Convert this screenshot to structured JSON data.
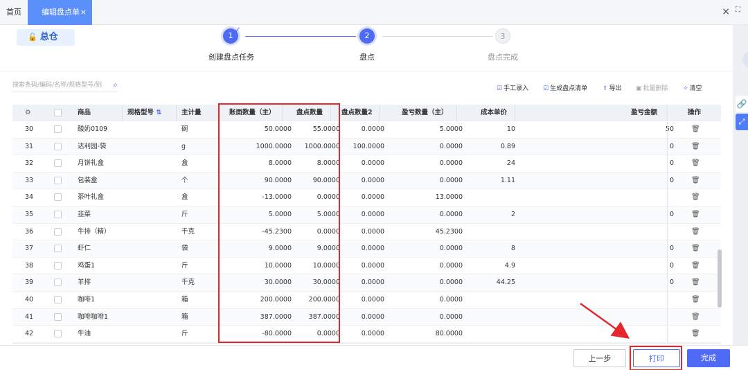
{
  "tabs": {
    "home": "首页",
    "active": "编辑盘点单",
    "close": "×"
  },
  "window": {
    "close": "×",
    "fullscreen": "⛶"
  },
  "warehouse": {
    "name": "总仓"
  },
  "steps": [
    {
      "num": "1",
      "label": "创建盘点任务",
      "state": "done"
    },
    {
      "num": "2",
      "label": "盘点",
      "state": "current"
    },
    {
      "num": "3",
      "label": "盘点完成",
      "state": "todo"
    }
  ],
  "search": {
    "placeholder": "搜索条码/编码/名称/规格型号/别"
  },
  "toolbar": {
    "manual": "手工录入",
    "generate": "生成盘点清单",
    "export": "导出",
    "batch_delete": "批量删除",
    "clear": "清空"
  },
  "table": {
    "headers": {
      "product": "商品",
      "spec": "规格型号",
      "unit": "主计量",
      "book_qty": "账面数量（主）",
      "count_qty": "盘点数量",
      "count_qty2": "盘点数量2",
      "diff_qty": "盈亏数量（主）",
      "unit_cost": "成本单价",
      "diff_amount": "盈亏金额",
      "op": "操作"
    },
    "rows": [
      {
        "no": "30",
        "name": "酸奶0109",
        "unit": "碗",
        "book": "50.0000",
        "count": "55.0000",
        "count2": "0.0000",
        "diff": "5.0000",
        "cost": "10",
        "amount": "50"
      },
      {
        "no": "31",
        "name": "达利园-袋",
        "unit": "g",
        "book": "1000.0000",
        "count": "1000.0000",
        "count2": "100.0000",
        "diff": "0.0000",
        "cost": "0.89",
        "amount": "0"
      },
      {
        "no": "32",
        "name": "月饼礼盒",
        "unit": "盒",
        "book": "8.0000",
        "count": "8.0000",
        "count2": "0.0000",
        "diff": "0.0000",
        "cost": "24",
        "amount": "0"
      },
      {
        "no": "33",
        "name": "包装盒",
        "unit": "个",
        "book": "90.0000",
        "count": "90.0000",
        "count2": "0.0000",
        "diff": "0.0000",
        "cost": "1.11",
        "amount": "0"
      },
      {
        "no": "34",
        "name": "茶叶礼盒",
        "unit": "盒",
        "book": "-13.0000",
        "count": "0.0000",
        "count2": "0.0000",
        "diff": "13.0000",
        "cost": "",
        "amount": ""
      },
      {
        "no": "35",
        "name": "韭菜",
        "unit": "斤",
        "book": "5.0000",
        "count": "5.0000",
        "count2": "0.0000",
        "diff": "0.0000",
        "cost": "2",
        "amount": "0"
      },
      {
        "no": "36",
        "name": "牛排（精）",
        "unit": "千克",
        "book": "-45.2300",
        "count": "0.0000",
        "count2": "0.0000",
        "diff": "45.2300",
        "cost": "",
        "amount": ""
      },
      {
        "no": "37",
        "name": "虾仁",
        "unit": "袋",
        "book": "9.0000",
        "count": "9.0000",
        "count2": "0.0000",
        "diff": "0.0000",
        "cost": "8",
        "amount": "0"
      },
      {
        "no": "38",
        "name": "鸡蛋1",
        "unit": "斤",
        "book": "10.0000",
        "count": "10.0000",
        "count2": "0.0000",
        "diff": "0.0000",
        "cost": "4.9",
        "amount": "0"
      },
      {
        "no": "39",
        "name": "羊排",
        "unit": "千克",
        "book": "30.0000",
        "count": "30.0000",
        "count2": "0.0000",
        "diff": "0.0000",
        "cost": "44.25",
        "amount": "0"
      },
      {
        "no": "40",
        "name": "咖啡1",
        "unit": "箱",
        "book": "200.0000",
        "count": "200.0000",
        "count2": "0.0000",
        "diff": "0.0000",
        "cost": "",
        "amount": ""
      },
      {
        "no": "41",
        "name": "咖啡咖啡1",
        "unit": "箱",
        "book": "387.0000",
        "count": "387.0000",
        "count2": "0.0000",
        "diff": "0.0000",
        "cost": "",
        "amount": ""
      },
      {
        "no": "42",
        "name": "牛油",
        "unit": "斤",
        "book": "-80.0000",
        "count": "0.0000",
        "count2": "0.0000",
        "diff": "80.0000",
        "cost": "",
        "amount": ""
      }
    ]
  },
  "footer": {
    "prev": "上一步",
    "print": "打印",
    "done": "完成"
  },
  "colors": {
    "accent": "#4f6bf5",
    "highlight": "#e6262d",
    "tab": "#5b8ff9"
  },
  "icons": {
    "trash": "trash-icon",
    "gear": "gear-icon",
    "search": "search-icon"
  }
}
